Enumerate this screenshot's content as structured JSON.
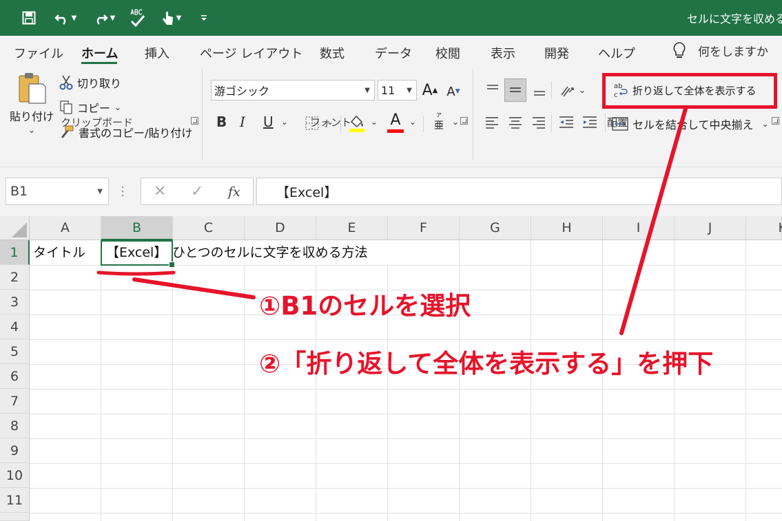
{
  "title_bar": {
    "document_title": "セルに文字を収める"
  },
  "ribbon_tabs": [
    "ファイル",
    "ホーム",
    "挿入",
    "ページ レイアウト",
    "数式",
    "データ",
    "校閲",
    "表示",
    "開発",
    "ヘルプ"
  ],
  "active_tab": "ホーム",
  "tell_me": {
    "label": "何をしますか"
  },
  "clipboard": {
    "paste_label": "貼り付け",
    "cut_label": "切り取り",
    "copy_label": "コピー",
    "format_painter_label": "書式のコピー/貼り付け",
    "group_label": "クリップボード"
  },
  "font": {
    "font_name": "游ゴシック",
    "font_size": "11",
    "grow_label": "A",
    "shrink_label": "A",
    "bold_label": "B",
    "italic_label": "I",
    "underline_label": "U",
    "font_color_label": "A",
    "phonetic_label": "亜",
    "group_label": "フォント",
    "highlight_color": "#ffff00",
    "font_color": "#ff0000"
  },
  "alignment": {
    "wrap_text_label": "折り返して全体を表示する",
    "wrap_icon_text": "ab",
    "merge_center_label": "セルを結合して中央揃え",
    "group_label": "配置"
  },
  "formula_bar": {
    "name_box": "B1",
    "cancel": "✕",
    "enter": "✓",
    "fx": "fx",
    "content": "【Excel】"
  },
  "grid": {
    "columns": [
      "A",
      "B",
      "C",
      "D",
      "E",
      "F",
      "G",
      "H",
      "I",
      "J",
      "K"
    ],
    "rows": [
      "1",
      "2",
      "3",
      "4",
      "5",
      "6",
      "7",
      "8",
      "9",
      "10",
      "11"
    ],
    "selected_column": "B",
    "selected_row": "1",
    "cells": {
      "A1": "タイトル",
      "B1": "【Excel】",
      "B1_overflow": "ひとつのセルに文字を収める方法"
    }
  },
  "annotations": {
    "step1": "①B1のセルを選択",
    "step2": "②「折り返して全体を表示する」を押下",
    "color": "#e6142b"
  },
  "theme": {
    "excel_green": "#217346"
  }
}
